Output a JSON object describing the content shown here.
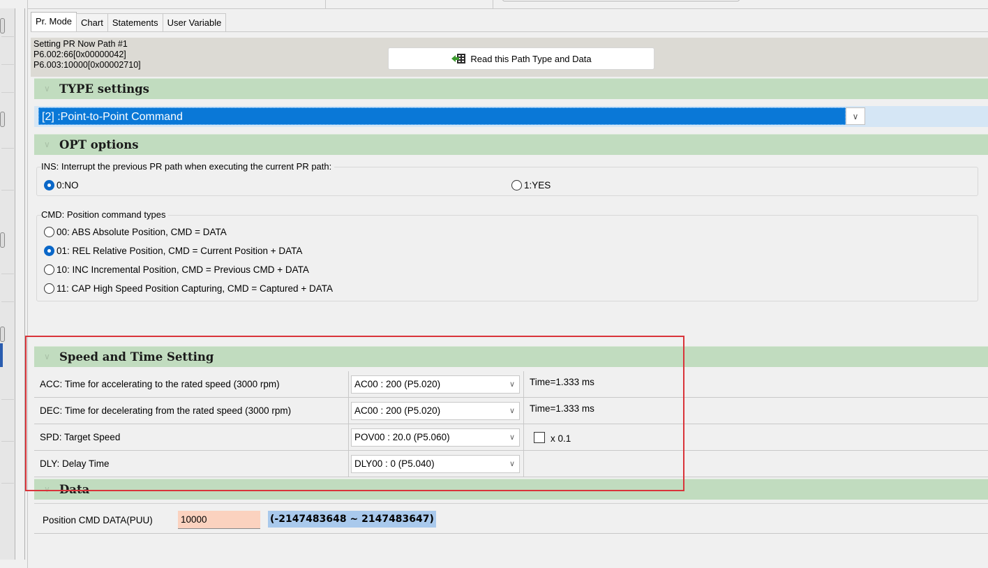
{
  "tabs": [
    {
      "label": "Pr. Mode"
    },
    {
      "label": "Chart"
    },
    {
      "label": "Statements"
    },
    {
      "label": "User Variable"
    }
  ],
  "info": {
    "line1": "Setting PR Now Path #1",
    "line2": "P6.002:66[0x00000042]",
    "line3": "P6.003:10000[0x00002710]",
    "read_button": "Read this Path Type and Data",
    "read_icon": "read-data-icon"
  },
  "type_settings": {
    "title": "TYPE settings",
    "selected": "[2] :Point-to-Point Command"
  },
  "opt_options": {
    "title": "OPT options",
    "ins": {
      "legend": "INS: Interrupt the previous PR path when executing the current PR path:",
      "options": [
        "0:NO",
        "1:YES"
      ],
      "selected": "0:NO"
    },
    "cmd": {
      "legend": "CMD: Position command types",
      "options": [
        "00: ABS Absolute Position, CMD = DATA",
        "01: REL Relative Position, CMD = Current Position + DATA",
        "10: INC Incremental Position, CMD = Previous CMD + DATA",
        "11: CAP High Speed Position Capturing, CMD = Captured + DATA"
      ],
      "selected": "01: REL Relative Position, CMD = Current Position + DATA"
    }
  },
  "speed": {
    "title": "Speed and Time Setting",
    "rows": [
      {
        "label": "ACC: Time for accelerating to the rated speed (3000 rpm)",
        "value": "AC00 : 200 (P5.020)",
        "note": "Time=1.333 ms"
      },
      {
        "label": "DEC: Time for decelerating from the rated speed (3000 rpm)",
        "value": "AC00 : 200 (P5.020)",
        "note": "Time=1.333 ms"
      },
      {
        "label": "SPD: Target Speed",
        "value": "POV00 : 20.0 (P5.060)",
        "checkbox_label": "x 0.1",
        "checked": false
      },
      {
        "label": "DLY: Delay Time",
        "value": "DLY00 : 0 (P5.040)"
      }
    ]
  },
  "data": {
    "title": "Data",
    "label": "Position CMD DATA(PUU)",
    "value": "10000",
    "range": "(-2147483648 ~ 2147483647)"
  },
  "colors": {
    "section_header": "#c1dcbf",
    "selection": "#0a78d7",
    "highlight_border": "#d9343a",
    "input_bg": "#fbd2bf",
    "range_bg": "#a9c9ec"
  }
}
